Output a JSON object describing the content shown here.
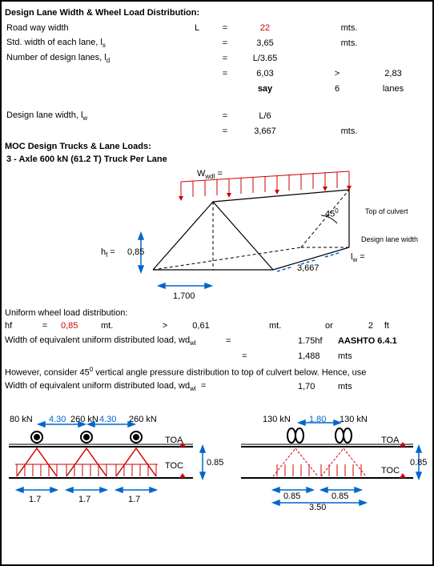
{
  "section1": {
    "title": "Design Lane Width & Wheel Load Distribution:",
    "road_way_label": "Road way width",
    "L": "L",
    "eq": "=",
    "road_way_val": "22",
    "mts": "mts.",
    "std_width_label": "Std. width of each lane, l",
    "std_width_sub": "s",
    "std_width_val": "3,65",
    "num_lanes_label": "Number of design lanes, l",
    "num_lanes_sub": "d",
    "num_lanes_expr": "L/3.65",
    "num_lanes_val": "6,03",
    "gt": ">",
    "num_lanes_thresh": "2,83",
    "say": "say",
    "say_val": "6",
    "lanes": "lanes",
    "design_lane_label": "Design lane width, l",
    "design_lane_sub": "w",
    "design_lane_expr": "L/6",
    "design_lane_val": "3,667"
  },
  "section2": {
    "title": "MOC Design Trucks & Lane Loads:",
    "subtitle": "3 - Axle 600 kN (61.2 T) Truck Per Lane",
    "Wwdl": "W",
    "Wwdl_sub": "wdl",
    "Wwdl_eq": "=",
    "angle45": "45",
    "angle_sup": "0",
    "top_culvert": "Top of culvert",
    "design_lane_width": "Design lane width",
    "lw": "l",
    "lw_sub": "w",
    "lw_eq": "=",
    "hf": "h",
    "hf_sub": "f",
    "hf_eq": "=",
    "hf_val": "0,85",
    "width_val": "3,667",
    "base_val": "1,700"
  },
  "section3": {
    "title": "Uniform wheel load distribution:",
    "hf_label": "hf",
    "eq": "=",
    "hf_val": "0,85",
    "mt": "mt.",
    "gt": ">",
    "thresh": "0,61",
    "or": "or",
    "ft_val": "2",
    "ft": "ft",
    "wdwl_label": "Width of equivalent uniform distributed load, wd",
    "wdwl_sub": "wl",
    "wdwl_eq": "=",
    "wdwl_expr": "1.75hf",
    "aashto": "AASHTO 6.4.1",
    "wdwl_val": "1,488",
    "mts": "mts",
    "note": "However, consider 45",
    "note_sup": "0",
    "note_rest": " vertical angle pressure distribution to top of culvert below. Hence, use",
    "wdwl2_val": "1,70"
  },
  "diag_bottom": {
    "kn80": "80 kN",
    "kn260": "260 kN",
    "sp430": "4.30",
    "kn130": "130 kN",
    "sp180": "1.80",
    "toa": "TOA",
    "toc": "TOC",
    "h085": "0.85",
    "w17": "1.7",
    "w085": "0.85",
    "w350": "3.50"
  }
}
